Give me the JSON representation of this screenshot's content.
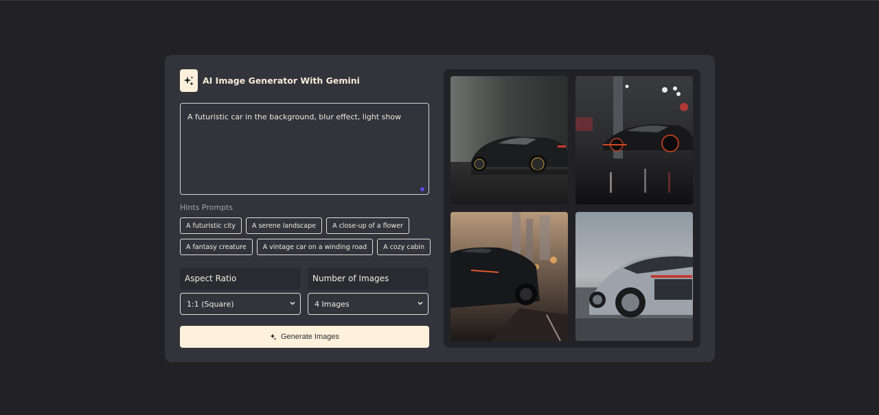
{
  "app": {
    "title": "AI Image Generator With Gemini"
  },
  "prompt": {
    "value": "A futuristic car in the background, blur effect, light show"
  },
  "hints": {
    "label": "Hints Prompts",
    "items": [
      "A futuristic city",
      "A serene landscape",
      "A close-up of a flower",
      "A fantasy creature",
      "A vintage car on a winding road",
      "A cozy cabin"
    ]
  },
  "aspect_ratio": {
    "label": "Aspect Ratio",
    "selected": "1:1 (Square)"
  },
  "number_of_images": {
    "label": "Number of Images",
    "selected": "4 Images"
  },
  "generate": {
    "label": "Generate Images",
    "icon": "sparkle-icon"
  },
  "gallery": {
    "images": [
      {
        "name": "generated-image-1"
      },
      {
        "name": "generated-image-2"
      },
      {
        "name": "generated-image-3"
      },
      {
        "name": "generated-image-4"
      }
    ]
  },
  "colors": {
    "background": "#222226",
    "card": "#32333b",
    "accent": "#fdf1dc"
  }
}
